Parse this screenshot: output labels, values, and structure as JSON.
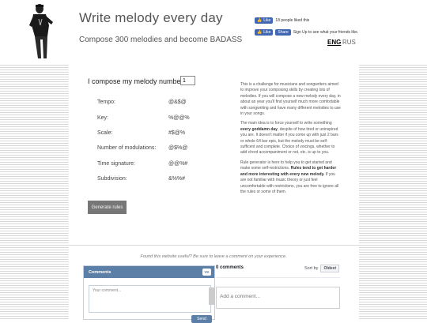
{
  "header": {
    "title": "Write melody every day",
    "subtitle": "Compose 300 melodies and become BADASS"
  },
  "facebook": {
    "like_label": "Like",
    "like_text": "18 people liked this",
    "like_button_label": "Like",
    "share_label": "Share",
    "signup_text": "Sign Up to see what your friends like."
  },
  "lang": {
    "eng": "ENG",
    "rus": "RUS"
  },
  "form": {
    "compose_label": "I compose my melody number",
    "melody_number": "1"
  },
  "params": [
    {
      "label": "Tempo:",
      "value": "@&$@"
    },
    {
      "label": "Key:",
      "value": "%@@%"
    },
    {
      "label": "Scale:",
      "value": "#$@%"
    },
    {
      "label": "Number of modulations:",
      "value": "@$%@"
    },
    {
      "label": "Time signature:",
      "value": "@@%#"
    },
    {
      "label": "Subdivision:",
      "value": "&%%#"
    }
  ],
  "generate_button": "Generate rules",
  "description": {
    "p1": "This is a challenge for musicians and songwriters aimed to improve your composing skills by creating lots of melodies. If you will compose a new melody every day, in about an year you'll find yourself much more comfortable with songwriting and have many different melodies to use in your songs.",
    "p2_a": "The main idea is to force yourself to write something ",
    "p2_b": "every goddamn day",
    "p2_c": ", despite of how tired or uninspired you are. It doesn't matter if you come up with just 2 bars or whole 64 bar epic, but the melody must be self-sufficent and complete. Choice of voicings, whether to add chord accompaniment or not, etc. is up to you.",
    "p3_a": "Rule generator is here to help you to get started and make some self-restrictions. ",
    "p3_b": "Rules tend to get harder and more interesting with every new melody.",
    "p3_c": " If you are not familiar with music theory or just feel uncomfortable with restrictions, you are free to ignore all the rules or some of them."
  },
  "helpful_text": "Found this website useful? Be sure to leave a comment on your experience.",
  "vk": {
    "header": "Comments",
    "logo": "VK",
    "placeholder": "Your comment...",
    "send": "Send"
  },
  "fb_comments": {
    "count": "0 comments",
    "sort_label": "Sort by",
    "sort_value": "Oldest",
    "add_placeholder": "Add a comment..."
  }
}
